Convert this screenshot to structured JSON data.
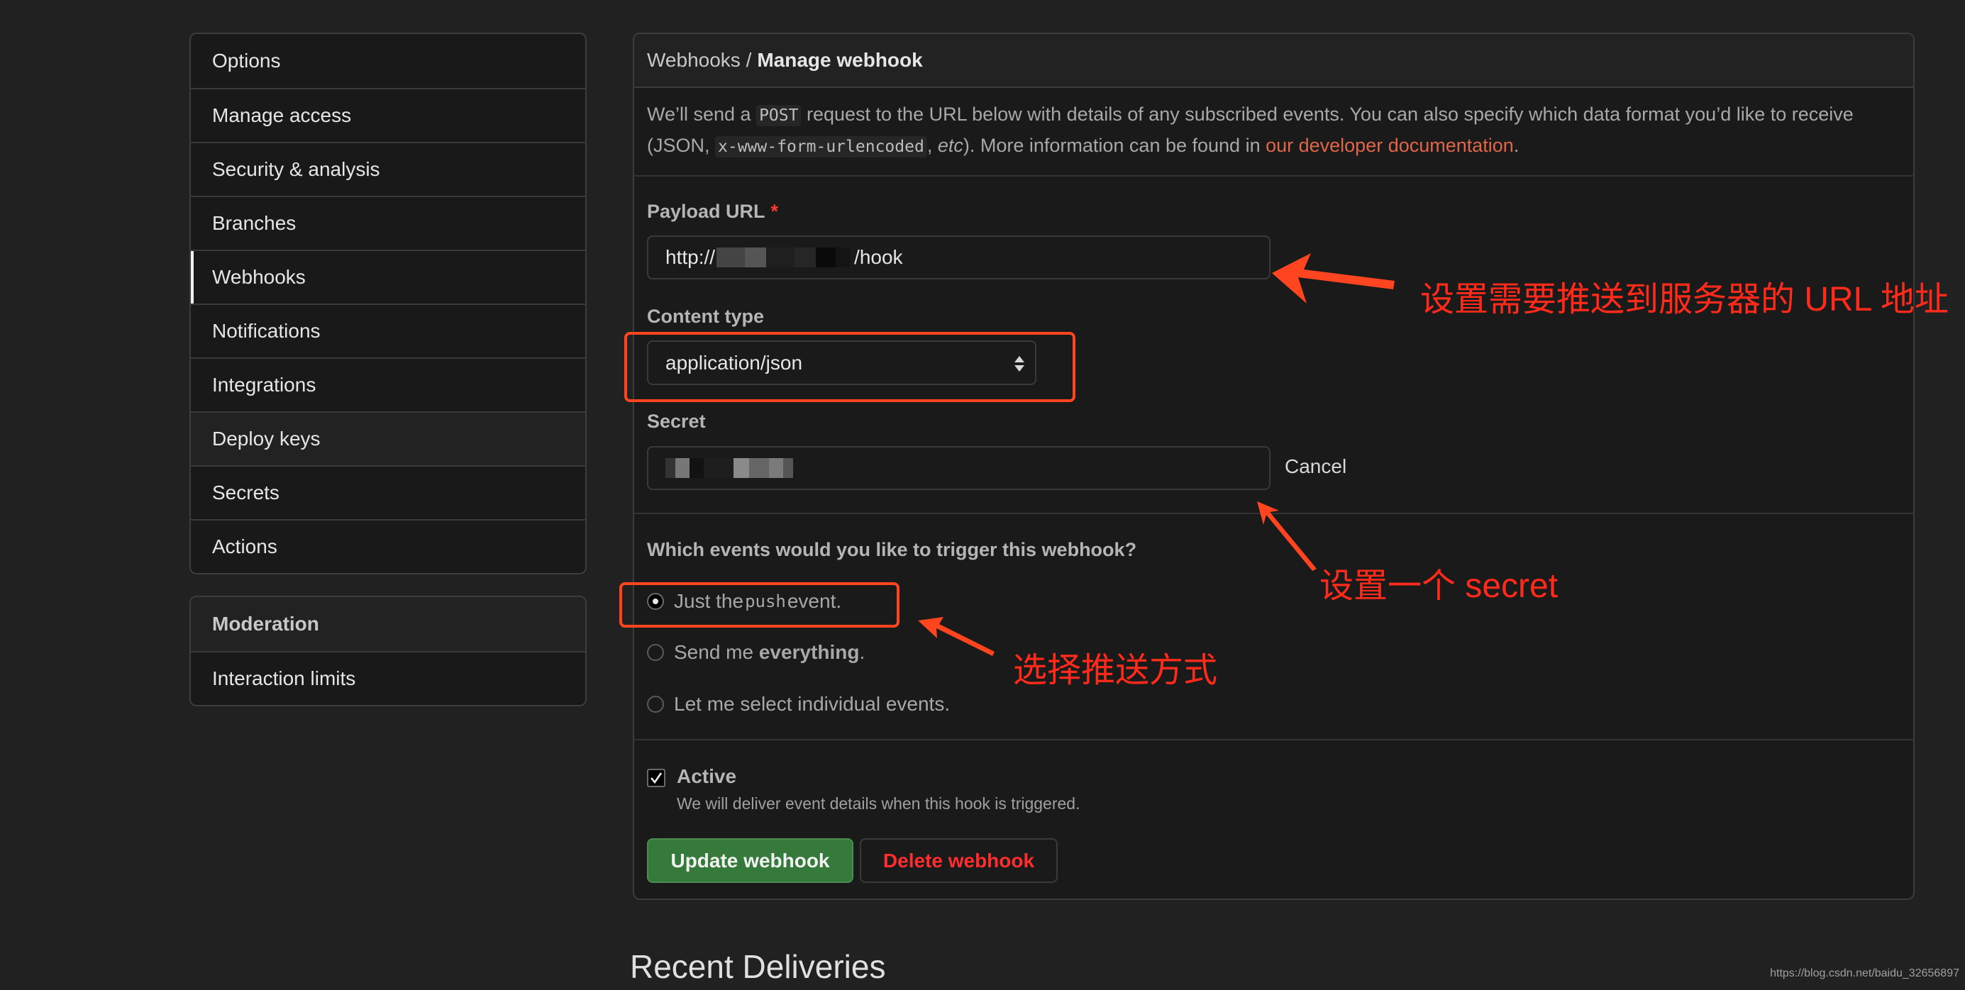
{
  "sidebar": {
    "items": [
      {
        "label": "Options"
      },
      {
        "label": "Manage access"
      },
      {
        "label": "Security & analysis"
      },
      {
        "label": "Branches"
      },
      {
        "label": "Webhooks",
        "selected": true
      },
      {
        "label": "Notifications"
      },
      {
        "label": "Integrations"
      },
      {
        "label": "Deploy keys"
      },
      {
        "label": "Secrets"
      },
      {
        "label": "Actions"
      }
    ],
    "moderation": {
      "heading": "Moderation",
      "items": [
        {
          "label": "Interaction limits"
        }
      ]
    }
  },
  "panel": {
    "breadcrumb_parent": "Webhooks /",
    "breadcrumb_current": "Manage webhook",
    "description": {
      "part1": "We’ll send a ",
      "code1": "POST",
      "part2": " request to the URL below with details of any subscribed events. You can also specify which data format you’d like to receive (JSON, ",
      "code2": "x-www-form-urlencoded",
      "part3": ", ",
      "etc": "etc",
      "part4": "). More information can be found in ",
      "link": "our developer documentation",
      "part5": "."
    },
    "payload_url": {
      "label": "Payload URL",
      "required_mark": "*",
      "value_prefix": "http://",
      "value_suffix": "/hook"
    },
    "content_type": {
      "label": "Content type",
      "selected": "application/json"
    },
    "secret": {
      "label": "Secret",
      "cancel": "Cancel"
    },
    "events": {
      "question": "Which events would you like to trigger this webhook?",
      "options": [
        {
          "pre": "Just the ",
          "code": "push",
          "post": " event.",
          "checked": true
        },
        {
          "pre": "Send me ",
          "bold": "everything",
          "post": ".",
          "checked": false
        },
        {
          "pre": "Let me select individual events.",
          "checked": false
        }
      ]
    },
    "active": {
      "label": "Active",
      "checked": true,
      "description": "We will deliver event details when this hook is triggered."
    },
    "buttons": {
      "update": "Update webhook",
      "delete": "Delete webhook"
    }
  },
  "recent_deliveries": "Recent Deliveries",
  "watermark": "https://blog.csdn.net/baidu_32656897",
  "annotations": {
    "url_note": "设置需要推送到服务器的 URL 地址",
    "secret_note": "设置一个 secret",
    "event_note": "选择推送方式"
  },
  "colors": {
    "annotation": "#ff4520",
    "link": "#e0664a",
    "update_button": "#357a3b",
    "delete_text": "#ff2d2d"
  }
}
